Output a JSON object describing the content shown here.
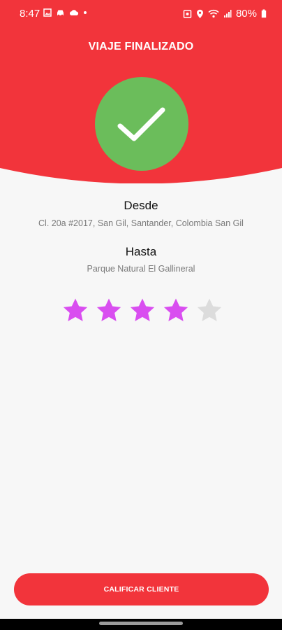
{
  "status_bar": {
    "time": "8:47",
    "battery_text": "80%",
    "left_icons": [
      "gallery-icon",
      "car-icon",
      "cloud-icon",
      "dot-icon"
    ],
    "right_icons": [
      "alarm-icon",
      "location-icon",
      "wifi-icon",
      "signal-icon",
      "battery-icon"
    ]
  },
  "header": {
    "title": "VIAJE FINALIZADO",
    "bg_color": "#f2343b",
    "check_color": "#6bbd5b"
  },
  "trip": {
    "from_label": "Desde",
    "from_value": "Cl. 20a #2017, San Gil, Santander, Colombia San Gil",
    "to_label": "Hasta",
    "to_value": "Parque Natural El Gallineral"
  },
  "rating": {
    "value": 4,
    "max": 5,
    "filled_color": "#d94ef0",
    "empty_color": "#dcdcdc"
  },
  "actions": {
    "rate_client_label": "CALIFICAR CLIENTE"
  }
}
